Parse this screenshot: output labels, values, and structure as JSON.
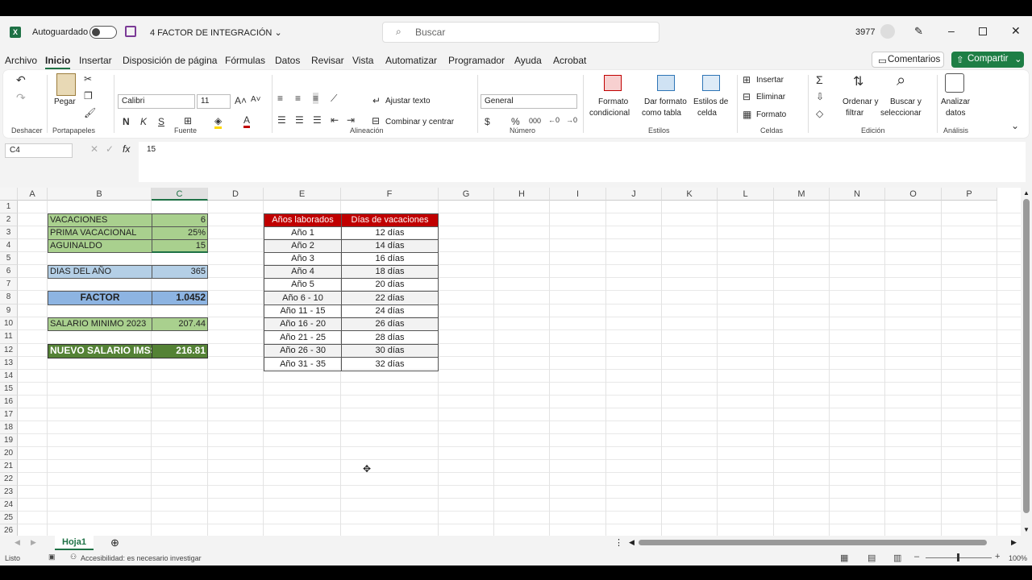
{
  "titlebar": {
    "autosave_label": "Autoguardado",
    "filename": "4 FACTOR DE INTEGRACIÓN",
    "search_placeholder": "Buscar",
    "user_number": "3977"
  },
  "menu": [
    "Archivo",
    "Inicio",
    "Insertar",
    "Disposición de página",
    "Fórmulas",
    "Datos",
    "Revisar",
    "Vista",
    "Automatizar",
    "Programador",
    "Ayuda",
    "Acrobat"
  ],
  "menu_active": "Inicio",
  "header_buttons": {
    "comments": "Comentarios",
    "share": "Compartir"
  },
  "ribbon": {
    "groups": {
      "undo": "Deshacer",
      "clipboard": "Portapapeles",
      "font": "Fuente",
      "alignment": "Alineación",
      "number": "Número",
      "styles": "Estilos",
      "cells": "Celdas",
      "editing": "Edición",
      "analysis": "Análisis"
    },
    "paste": "Pegar",
    "font_name": "Calibri",
    "font_size": "11",
    "bold": "N",
    "italic": "K",
    "underline": "S",
    "wrap_text": "Ajustar texto",
    "merge_center": "Combinar y centrar",
    "number_format": "General",
    "conditional_format": [
      "Formato",
      "condicional"
    ],
    "format_table": [
      "Dar formato",
      "como tabla"
    ],
    "cell_styles": [
      "Estilos de",
      "celda"
    ],
    "insert": "Insertar",
    "delete": "Eliminar",
    "format": "Formato",
    "sort_filter": [
      "Ordenar y",
      "filtrar"
    ],
    "find_select": [
      "Buscar y",
      "seleccionar"
    ],
    "analyze": [
      "Analizar",
      "datos"
    ]
  },
  "formula_bar": {
    "name_box": "C4",
    "fx": "fx",
    "value": "15"
  },
  "columns": [
    "A",
    "B",
    "C",
    "D",
    "E",
    "F",
    "G",
    "H",
    "I",
    "J",
    "K",
    "L",
    "M",
    "N",
    "O",
    "P"
  ],
  "selected_column": "C",
  "rows": [
    "1",
    "2",
    "3",
    "4",
    "5",
    "6",
    "7",
    "8",
    "9",
    "10",
    "11",
    "12",
    "13",
    "14",
    "15",
    "16",
    "17",
    "18",
    "19",
    "20",
    "21",
    "22",
    "23",
    "24",
    "25",
    "26"
  ],
  "left_block": {
    "vacaciones": {
      "label": "VACACIONES",
      "value": "6"
    },
    "prima": {
      "label": "PRIMA VACACIONAL",
      "value": "25%"
    },
    "aguinaldo": {
      "label": "AGUINALDO",
      "value": "15"
    },
    "dias_anio": {
      "label": "DIAS DEL AÑO",
      "value": "365"
    },
    "factor": {
      "label": "FACTOR",
      "value": "1.0452"
    },
    "salario_min": {
      "label": "SALARIO MINIMO 2023",
      "value": "207.44"
    },
    "nuevo_salario": {
      "label": "NUEVO SALARIO IMSS",
      "value": "216.81"
    }
  },
  "vacation_table": {
    "headers": [
      "Años laborados",
      "Días de vacaciones"
    ],
    "rows": [
      [
        "Año 1",
        "12 días"
      ],
      [
        "Año 2",
        "14 días"
      ],
      [
        "Año 3",
        "16 días"
      ],
      [
        "Año 4",
        "18 días"
      ],
      [
        "Año 5",
        "20 días"
      ],
      [
        "Año 6 - 10",
        "22 días"
      ],
      [
        "Año 11 - 15",
        "24 días"
      ],
      [
        "Año 16 - 20",
        "26 días"
      ],
      [
        "Año 21 - 25",
        "28 días"
      ],
      [
        "Año 26 - 30",
        "30 días"
      ],
      [
        "Año 31 - 35",
        "32 días"
      ]
    ]
  },
  "sheet_tab": "Hoja1",
  "status": {
    "ready": "Listo",
    "accessibility": "Accesibilidad: es necesario investigar",
    "zoom": "100%"
  }
}
